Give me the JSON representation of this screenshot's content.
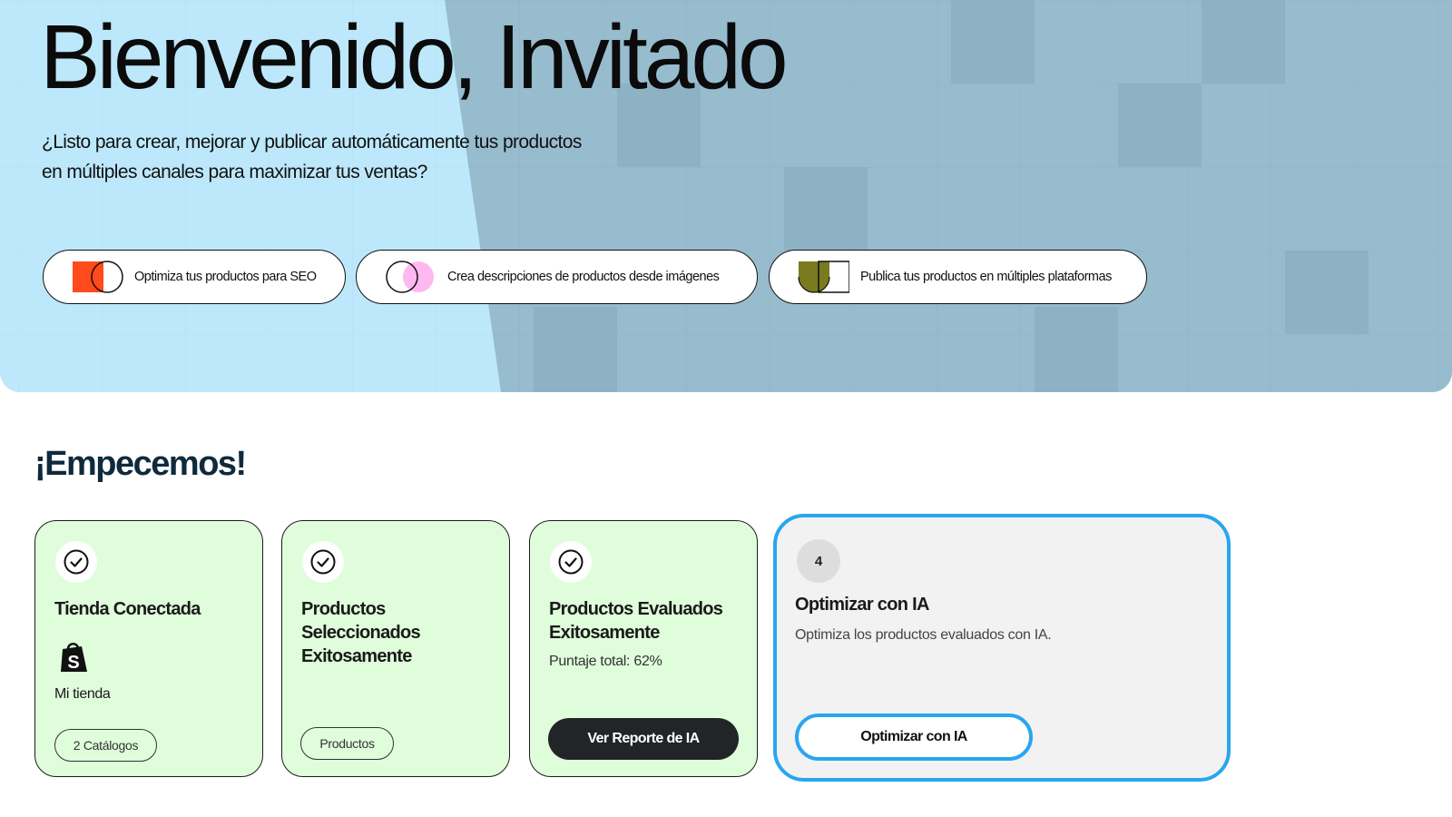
{
  "hero": {
    "title": "Bienvenido, Invitado",
    "subtitle": "¿Listo para crear, mejorar y publicar automáticamente tus productos en múltiples canales para maximizar tus ventas?",
    "features": [
      {
        "label": "Optimiza tus productos para SEO",
        "icon": "seo-venn-icon",
        "color": "#ff4a1c"
      },
      {
        "label": "Crea descripciones de productos desde imágenes",
        "icon": "image-venn-icon",
        "color": "#ffb8f0"
      },
      {
        "label": "Publica tus productos en múltiples plataformas",
        "icon": "platforms-venn-icon",
        "color": "#7a7a1e"
      }
    ]
  },
  "onboarding": {
    "title": "¡Empecemos!",
    "steps": [
      {
        "status": "completed",
        "title": "Tienda Conectada",
        "store_icon": "shopify-icon",
        "store_name": "Mi tienda",
        "tag": "2 Catálogos"
      },
      {
        "status": "completed",
        "title": "Productos Seleccionados Exitosamente",
        "tag": "Productos"
      },
      {
        "status": "completed",
        "title": "Productos Evaluados Exitosamente",
        "score": "Puntaje total: 62%",
        "button": "Ver Reporte de IA"
      },
      {
        "status": "current",
        "number": "4",
        "title": "Optimizar con IA",
        "description": "Optimiza los productos evaluados con IA.",
        "button": "Optimizar con IA"
      }
    ]
  },
  "colors": {
    "hero_light": "#bde8fb",
    "hero_dark": "#97bcce",
    "card_done": "#dffddb",
    "card_current": "#f3f2f2",
    "accent": "#29a6ef",
    "heading": "#0f2a3d"
  }
}
